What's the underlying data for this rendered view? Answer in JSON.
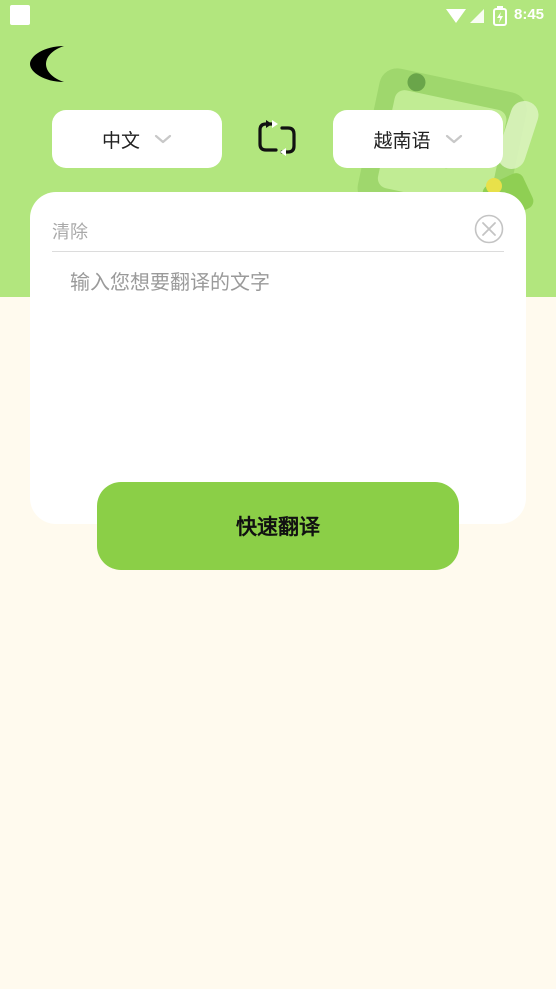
{
  "status_bar": {
    "time": "8:45"
  },
  "language_bar": {
    "source_language": "中文",
    "target_language": "越南语"
  },
  "input_card": {
    "clear_label": "清除",
    "placeholder": "输入您想要翻译的文字",
    "value": ""
  },
  "translate_button_label": "快速翻译",
  "icons": {
    "back": "back-crescent-icon",
    "swap": "swap-languages-icon",
    "dropdown": "chevron-down-icon",
    "clear": "close-circle-icon"
  },
  "colors": {
    "header": "#b2e67e",
    "accent_button": "#8bcf47",
    "page_background": "#fffaee"
  }
}
